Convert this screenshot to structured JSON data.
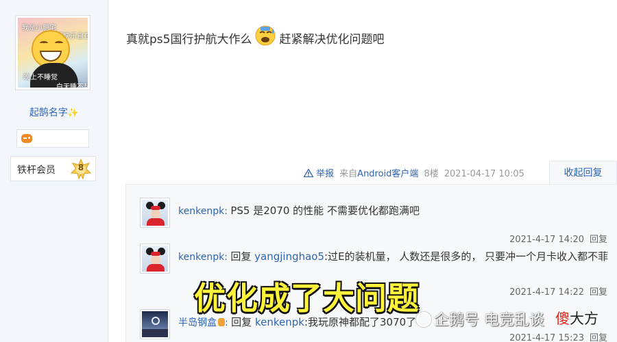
{
  "author": {
    "avatar_texts": [
      "我是小肥宅",
      "喝快乐自在",
      "晚上不睡觉",
      "白天睡不起"
    ],
    "username": "起鹄名字",
    "username_icon": "sparkles-icon",
    "badge_icon": "gamepad-icon",
    "member_label": "铁杆会员",
    "level": "8"
  },
  "post": {
    "text_before": "真就ps5国行护航大作么",
    "emoji": "sweat-face-emoji",
    "text_after": "赶紧解决优化问题吧",
    "meta": {
      "report": "举报",
      "source_prefix": "来自",
      "source": "Android客户端",
      "floor": "8楼",
      "time": "2021-04-17 10:05"
    },
    "collapse_label": "收起回复"
  },
  "replies": [
    {
      "user": "kenkenpk",
      "prefix": "",
      "target": "",
      "text": "PS5 是2070 的性能 不需要优化都跑满吧",
      "time": "2021-4-17 14:20",
      "reply_label": "回复"
    },
    {
      "user": "kenkenpk",
      "prefix": "回复 ",
      "target": "yangjinghao5",
      "text": ":过E的装机量， 人数还是很多的， 只要冲一个月卡收入都不菲",
      "time": "2021-4-17 14:22",
      "reply_label": "回复"
    },
    {
      "user": "半岛钢盒",
      "prefix": "回复 ",
      "target": "kenkenpk",
      "text": ":我玩原神都配了3070了",
      "time": "2021-4-17 15:23",
      "reply_label": "回复"
    }
  ],
  "overlay": {
    "subtitle": "优化成了大问题",
    "watermark": "企鹅号 电竞乱谈",
    "brand_red": "傻",
    "brand_dark": "大方"
  }
}
